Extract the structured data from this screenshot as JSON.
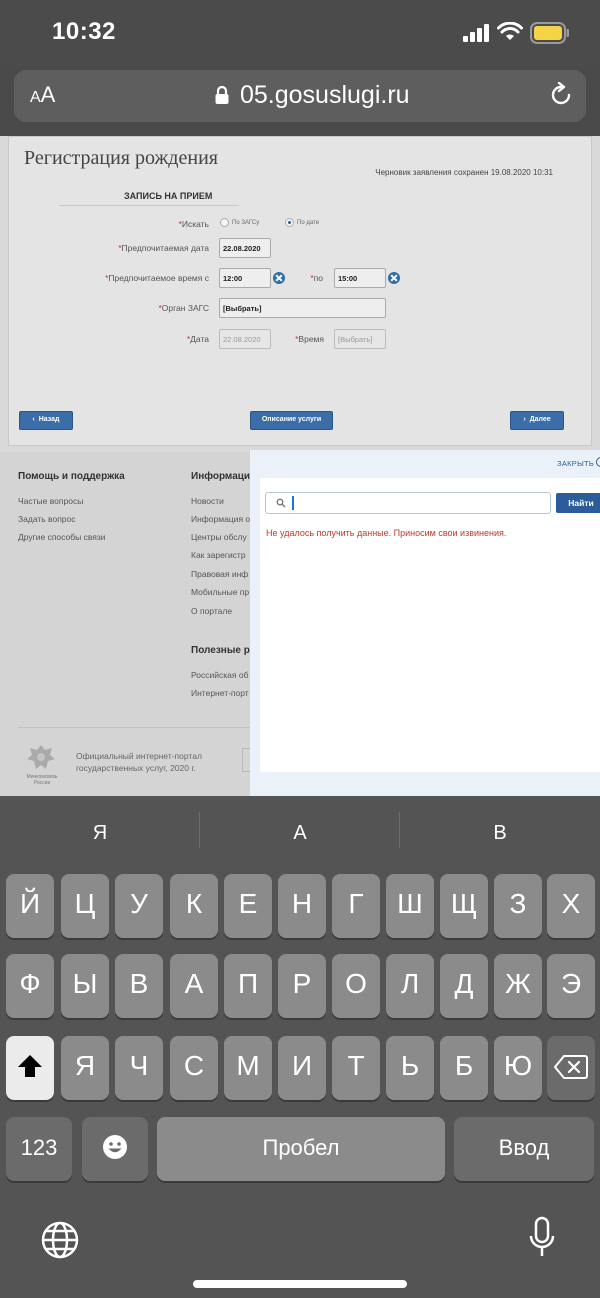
{
  "status_bar": {
    "time": "10:32"
  },
  "browser": {
    "aa_small": "A",
    "aa_large": "A",
    "url": "05.gosuslugi.ru"
  },
  "form": {
    "title": "Регистрация рождения",
    "draft_note": "Черновик заявления сохранен 19.08.2020 10:31",
    "section_title": "ЗАПИСЬ НА ПРИЕМ",
    "search_label": "Искать",
    "radio_by_office": "По ЗАГСу",
    "radio_by_date": "По дате",
    "pref_date_label": "Предпочитаемая дата",
    "pref_date_value": "22.08.2020",
    "pref_time_label": "Предпочитаемое время с",
    "time_from_value": "12:00",
    "to_label": "по",
    "time_to_value": "15:00",
    "office_label": "Орган ЗАГС",
    "office_value": "[Выбрать]",
    "date_label": "Дата",
    "date_value": "22.08.2020",
    "time_label": "Время",
    "time_value": "[Выбрать]",
    "back_button": "Назад",
    "service_button": "Описание услуги",
    "next_button": "Далее"
  },
  "footer": {
    "support_heading": "Помощь и поддержка",
    "support_links": [
      "Частые вопросы",
      "Задать вопрос",
      "Другие способы связи"
    ],
    "info_heading": "Информаци",
    "info_links": [
      "Новости",
      "Информация о",
      "Центры обслу",
      "Как зарегистр",
      "Правовая инф",
      "Мобильные пр",
      "О портале"
    ],
    "useful_heading": "Полезные р",
    "useful_links": [
      "Российская об",
      "Интернет-порт"
    ],
    "logo_caption": "Минкомсвязь России",
    "copyright_line1": "Официальный интернет-портал",
    "copyright_line2": "государственных услуг, 2020 г."
  },
  "search": {
    "close_label": "ЗАКРЫТЬ",
    "input_value": "",
    "button_label": "Найти",
    "error_message": "Не удалось получить данные. Приносим свои извинения."
  },
  "keyboard": {
    "suggestions": [
      "Я",
      "А",
      "В"
    ],
    "row1": [
      "Й",
      "Ц",
      "У",
      "К",
      "Е",
      "Н",
      "Г",
      "Ш",
      "Щ",
      "З",
      "Х"
    ],
    "row2": [
      "Ф",
      "Ы",
      "В",
      "А",
      "П",
      "Р",
      "О",
      "Л",
      "Д",
      "Ж",
      "Э"
    ],
    "row3": [
      "Я",
      "Ч",
      "С",
      "М",
      "И",
      "Т",
      "Ь",
      "Б",
      "Ю"
    ],
    "numbers_key": "123",
    "space_key": "Пробел",
    "return_key": "Ввод"
  },
  "colors": {
    "accent_blue": "#2a5d99",
    "error_red": "#c0392b",
    "battery_yellow": "#f5d547"
  }
}
